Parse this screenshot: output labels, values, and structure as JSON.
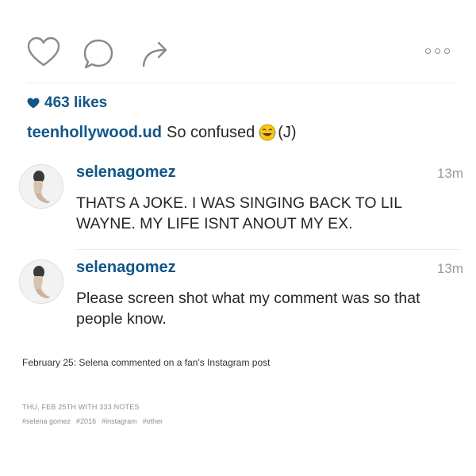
{
  "post": {
    "likes_text": "463 likes",
    "caption_user": "teenhollywood.ud",
    "caption_text": "So confused",
    "caption_suffix": "(J)"
  },
  "comments": [
    {
      "user": "selenagomez",
      "time": "13m",
      "text": "THATS A JOKE. I WAS SINGING BACK TO LIL WAYNE. MY LIFE ISNT ANOUT MY EX."
    },
    {
      "user": "selenagomez",
      "time": "13m",
      "text": "Please screen shot what my comment was so that people know."
    }
  ],
  "footer": {
    "note": "February 25: Selena commented on a fan's Instagram post",
    "meta": "THU, FEB 25TH WITH 333 NOTES",
    "tags": [
      "#selena gomez",
      "#2016",
      "#instagram",
      "#other"
    ]
  },
  "colors": {
    "link_blue": "#125688",
    "text": "#262626",
    "muted": "#9a9a9a"
  },
  "icons": {
    "like": "heart-outline-icon",
    "comment": "comment-bubble-icon",
    "share": "share-arrow-icon",
    "more": "more-dots-icon",
    "likes_heart": "heart-filled-icon",
    "caption_emoji": "laughing-crying-emoji-icon"
  }
}
